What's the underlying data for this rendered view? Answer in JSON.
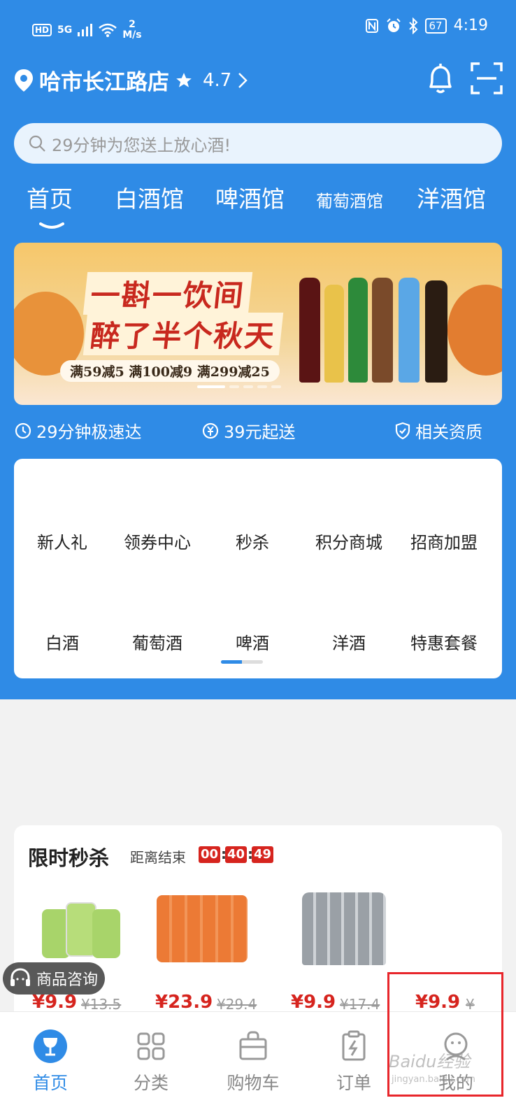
{
  "status": {
    "hd": "HD",
    "signal": "5G",
    "speed_value": "2",
    "speed_unit": "M/s",
    "icons": [
      "nfc-icon",
      "alarm-icon",
      "bluetooth-icon"
    ],
    "battery": "67",
    "time": "4:19"
  },
  "store": {
    "name": "哈市长江路店",
    "rating": "4.7"
  },
  "search": {
    "placeholder": "29分钟为您送上放心酒!"
  },
  "category_tabs": [
    "首页",
    "白酒馆",
    "啤酒馆",
    "葡萄酒馆",
    "洋酒馆"
  ],
  "banner": {
    "title_line1": "一斟一饮间",
    "title_line2": "醉了半个秋天",
    "promo": "满59减5 满100减9 满299减25"
  },
  "features": {
    "delivery": "29分钟极速达",
    "min_order": "39元起送",
    "qualification": "相关资质"
  },
  "quick_row1": [
    "新人礼",
    "领券中心",
    "秒杀",
    "积分商城",
    "招商加盟"
  ],
  "quick_row2": [
    "白酒",
    "葡萄酒",
    "啤酒",
    "洋酒",
    "特惠套餐"
  ],
  "flash_sale": {
    "title": "限时秒杀",
    "subtitle": "距离结束",
    "hours": "00",
    "minutes": "40",
    "seconds": "49",
    "products": [
      {
        "price": "¥9.9",
        "original": "¥13.5"
      },
      {
        "price": "¥23.9",
        "original": "¥29.4"
      },
      {
        "price": "¥9.9",
        "original": "¥17.4"
      },
      {
        "price": "¥9.9",
        "original": "¥"
      }
    ]
  },
  "consult_label": "商品咨询",
  "tabbar": [
    "首页",
    "分类",
    "购物车",
    "订单",
    "我的"
  ],
  "watermark": "Baidu经验",
  "watermark_sub": "jingyan.baidu.com",
  "colors": {
    "primary": "#2f8be6",
    "price_red": "#d6241e",
    "highlight": "#e8262b"
  }
}
